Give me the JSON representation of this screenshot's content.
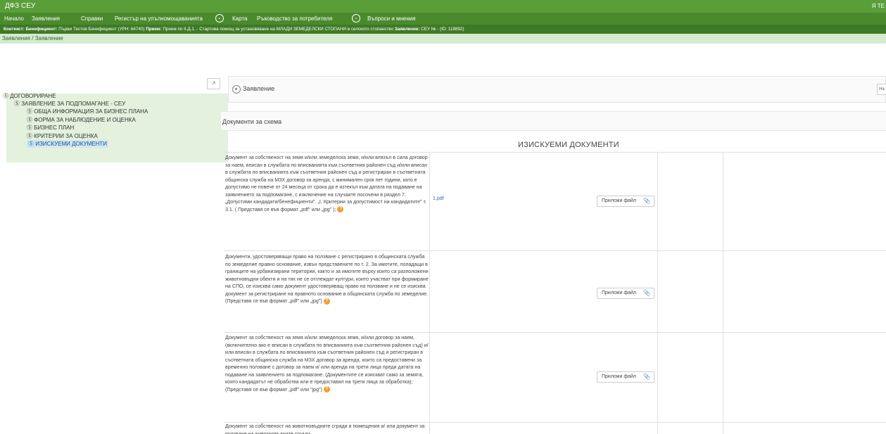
{
  "app": {
    "title": "ДФЗ СЕУ",
    "user": "Я ТЕ"
  },
  "nav": {
    "items": [
      {
        "label": "Начало"
      },
      {
        "label": "Заявления"
      },
      {
        "label": "Справки"
      },
      {
        "label": "Регистър на упълномощаванията"
      },
      {
        "label": "Карта"
      },
      {
        "label": "Ръководство за потребителя"
      },
      {
        "label": "Въпроси и мнения"
      }
    ]
  },
  "context": {
    "context_label": "Контекст:",
    "beneficiary_label": "Бенефициент:",
    "beneficiary_value": "Първи Тестов Бенефициент (УРН: 64740)",
    "reception_label": "Прием:",
    "reception_value": "Прием по II.Д.1. - Стартова помощ за установяване на МЛАДИ ЗЕМЕДЕЛСКИ СТОПАНИ в селското стопанство",
    "application_label": "Заявление:",
    "application_value": "СЕУ № - (ID: 118892)"
  },
  "breadcrumb": {
    "text": "Заявления / Заявление"
  },
  "tree": {
    "expand_icon": "↗",
    "nodes": [
      {
        "label": "Ⓢ ДОГОВОРИРАНЕ"
      },
      {
        "label": "Ⓢ ЗАЯВЛЕНИЕ ЗА ПОДПОМАГАНЕ - СЕУ"
      },
      {
        "label": "Ⓢ ОБЩА ИНФОРМАЦИЯ ЗА БИЗНЕС ПЛАНА"
      },
      {
        "label": "Ⓢ ФОРМА ЗА НАБЛЮДЕНИЕ И ОЦЕНКА"
      },
      {
        "label": "Ⓢ БИЗНЕС ПЛАН"
      },
      {
        "label": "Ⓢ КРИТЕРИИ ЗА ОЦЕНКА"
      },
      {
        "label": "Ⓢ ИЗИСКУЕМИ ДОКУМЕНТИ"
      }
    ]
  },
  "panel": {
    "label": "Заявление",
    "more_label": "На"
  },
  "docs": {
    "section_label": "Документи за схема",
    "title": "ИЗИСКУЕМИ ДОКУМЕНТИ",
    "attach_label": "Приложи файл",
    "rows": [
      {
        "text": "Документ за собственост на земя и/или земеделска земя, и/или влязъл в сила договор за наем, вписан в службата по вписванията към съответния районен съд и/или вписан в службата по вписванията към съответния районен съд и регистриран в съответната общинска служба на МЗХ договор за аренда, с минимален срок пет години, като е допустимо не повече от 24 месеца от срока да е изтекъл към датата на подаване на заявлението за подпомагане, с изключение на случаите посочени в раздел 7. „Допустими кандидати/бенефициенти\". „I. Критерии за допустимост на кандидатите\" т. 3.1. ( Представя се във формат „pdf\" или „jpg\" );",
        "file": "1.pdf"
      },
      {
        "text": "Документи, удостоверяващи право на ползване с регистрирано в общинската служба по земеделие правно основание, извън представените по т. 2. За имотите, попадащи в границите на урбанизирани територии, както и за имотите върху които са разположени животновъдни обекти и на тях не се отглеждат култури, които участват при формиране на СПО, се изисква само документ удостоверяващ право на ползване и не се изисква документ за регистриране на правното основание в общинската служба по земеделие. (Представя се във формат „pdf\" или „jpg\")",
        "file": ""
      },
      {
        "text": "Документ за собственост на земя и/или земеделска земя, и/или договор за наем, (включително ако е вписан в службата по вписванията към съответния районен съд) и/или вписан в службата по вписванията към съответния районен съд и регистриран в съответната общинска служба на МЗХ договор за аренда, които са предоставени за временно ползване с договор за наем и/ или аренда на трети лица преди датата на подаване на заявлението за подпомагане. (Документите се изискват само за земята, която кандидатът не обработва или е предоставил на трети лица за обработка); (Представя се във формат „pdf\" или \"jpg\")",
        "file": ""
      },
      {
        "text": "Документ за собственост на животновъдните сгради и помещения и/ или документ за ползване на животновъдните сгради",
        "file": ""
      }
    ]
  },
  "colors": {
    "accent": "#5a9e3a",
    "nav": "#4a8a2d",
    "context": "#3f7a27",
    "help": "#f0a030"
  }
}
